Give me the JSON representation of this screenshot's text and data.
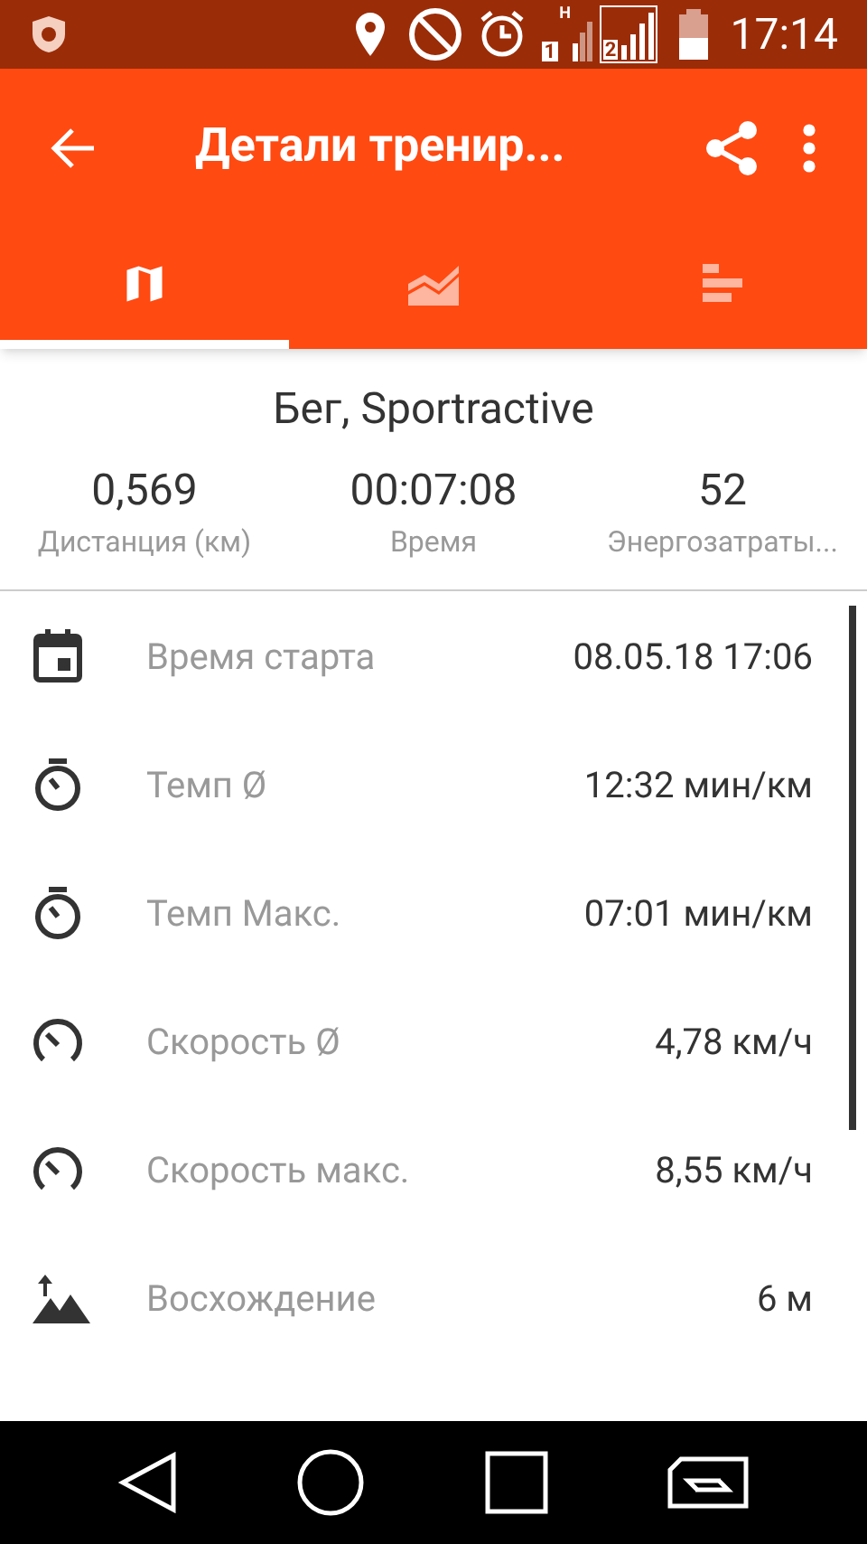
{
  "status_bar": {
    "time": "17:14",
    "sim1": "1",
    "sim2": "2",
    "network": "H"
  },
  "toolbar": {
    "title": "Детали тренир..."
  },
  "tabs": [
    {
      "kind": "map",
      "selected": true
    },
    {
      "kind": "chart",
      "selected": false
    },
    {
      "kind": "bars",
      "selected": false
    }
  ],
  "summary": {
    "title": "Бег, Sportractive",
    "stats": [
      {
        "value": "0,569",
        "label": "Дистанция (км)"
      },
      {
        "value": "00:07:08",
        "label": "Время"
      },
      {
        "value": "52",
        "label": "Энергозатраты..."
      }
    ]
  },
  "details": [
    {
      "kind": "calendar",
      "label": "Время старта",
      "value": "08.05.18 17:06"
    },
    {
      "kind": "timer",
      "label": "Темп Ø",
      "value": "12:32 мин/км"
    },
    {
      "kind": "timer",
      "label": "Темп Макс.",
      "value": "07:01 мин/км"
    },
    {
      "kind": "speed",
      "label": "Скорость Ø",
      "value": "4,78 км/ч"
    },
    {
      "kind": "speed",
      "label": "Скорость макс.",
      "value": "8,55 км/ч"
    },
    {
      "kind": "ascent",
      "label": "Восхождение",
      "value": "6 м"
    }
  ]
}
